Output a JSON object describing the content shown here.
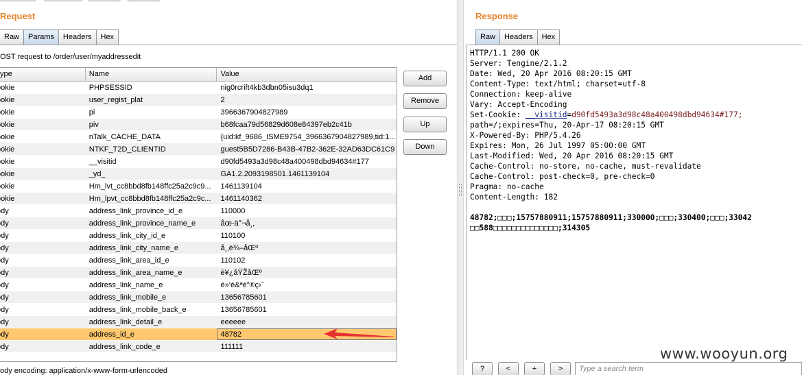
{
  "request": {
    "title": "Request",
    "tabs": [
      {
        "label": "Raw"
      },
      {
        "label": "Params"
      },
      {
        "label": "Headers"
      },
      {
        "label": "Hex"
      }
    ],
    "summary": "OST request to /order/user/myaddressedit",
    "columns": [
      "ype",
      "Name",
      "Value"
    ],
    "rows": [
      {
        "type": "ookie",
        "name": "PHPSESSID",
        "value": "nig0rcrift4kb3dbn05isu3dq1"
      },
      {
        "type": "ookie",
        "name": "user_regist_plat",
        "value": "2"
      },
      {
        "type": "ookie",
        "name": "pi",
        "value": "3966367904827989"
      },
      {
        "type": "ookie",
        "name": "piv",
        "value": "b68fcaa79d56829d608e84397eb2c41b"
      },
      {
        "type": "ookie",
        "name": "nTalk_CACHE_DATA",
        "value": "{uid:kf_9686_ISME9754_3966367904827989,tid:1..."
      },
      {
        "type": "ookie",
        "name": "NTKF_T2D_CLIENTID",
        "value": "guest5B5D7286-B43B-47B2-362E-32AD63DC61C9"
      },
      {
        "type": "ookie",
        "name": "__visitid",
        "value": "d90fd5493a3d98c48a400498dbd94634#177"
      },
      {
        "type": "ookie",
        "name": "_yd_",
        "value": "GA1.2.2093198501.1461139104"
      },
      {
        "type": "ookie",
        "name": "Hm_lvt_cc8bbd8fb148ffc25a2c9c9...",
        "value": "1461139104"
      },
      {
        "type": "ookie",
        "name": "Hm_lpvt_cc8bbd8fb148ffc25a2c9c...",
        "value": "1461140362"
      },
      {
        "type": "ody",
        "name": "address_link_province_id_e",
        "value": "110000"
      },
      {
        "type": "ody",
        "name": "address_link_province_name_e",
        "value": "åœ-ä°¬å¸‚"
      },
      {
        "type": "ody",
        "name": "address_link_city_id_e",
        "value": "110100"
      },
      {
        "type": "ody",
        "name": "address_link_city_name_e",
        "value": "å¸‚è¾–åŒº"
      },
      {
        "type": "ody",
        "name": "address_link_area_id_e",
        "value": "110102"
      },
      {
        "type": "ody",
        "name": "address_link_area_name_e",
        "value": "è¥¿åŸŽåŒº"
      },
      {
        "type": "ody",
        "name": "address_link_name_e",
        "value": "é»‘è&ªé”®ç›˜"
      },
      {
        "type": "ody",
        "name": "address_link_mobile_e",
        "value": "13656785601"
      },
      {
        "type": "ody",
        "name": "address_link_mobile_back_e",
        "value": "13656785601"
      },
      {
        "type": "ody",
        "name": "address_link_detail_e",
        "value": "eeeeee"
      },
      {
        "type": "ody",
        "name": "address_id_e",
        "value": "48782",
        "selected": true
      },
      {
        "type": "ody",
        "name": "address_link_code_e",
        "value": "111111"
      }
    ],
    "buttons": {
      "add": "Add",
      "remove": "Remove",
      "up": "Up",
      "down": "Down"
    },
    "encoding": "ody encoding:  application/x-www-form-urlencoded",
    "annotation_color": "#e53030"
  },
  "response": {
    "title": "Response",
    "tabs": [
      {
        "label": "Raw"
      },
      {
        "label": "Headers"
      },
      {
        "label": "Hex"
      }
    ],
    "lines": [
      "HTTP/1.1 200 OK",
      "Server: Tengine/2.1.2",
      "Date: Wed, 20 Apr 2016 08:20:15 GMT",
      "Content-Type: text/html; charset=utf-8",
      "Connection: keep-alive",
      "Vary: Accept-Encoding",
      "Set-Cookie: __visitid=d90fd5493a3d98c48a400498dbd94634#177;",
      "path=/;expires=Thu, 20-Apr-17 08:20:15 GMT",
      "X-Powered-By: PHP/5.4.26",
      "Expires: Mon, 26 Jul 1997 05:00:00 GMT",
      "Last-Modified: Wed, 20 Apr 2016 08:20:15 GMT",
      "Cache-Control: no-store, no-cache, must-revalidate",
      "Cache-Control: post-check=0, pre-check=0",
      "Pragma: no-cache",
      "Content-Length: 182"
    ],
    "cookie_name": "__visitid",
    "cookie_value": "d90fd5493a3d98c48a400498dbd94634#177;",
    "body_lines": [
      "48782;□□□;15757880911;15757880911;330000;□□□;330400;□□□;33042",
      "□□588□□□□□□□□□□□□□□;314305"
    ],
    "controls": {
      "help": "?",
      "prev": "<",
      "next_plus": "+",
      "next": ">"
    },
    "search_placeholder": "Type a search term"
  },
  "watermark": "www.wooyun.org"
}
